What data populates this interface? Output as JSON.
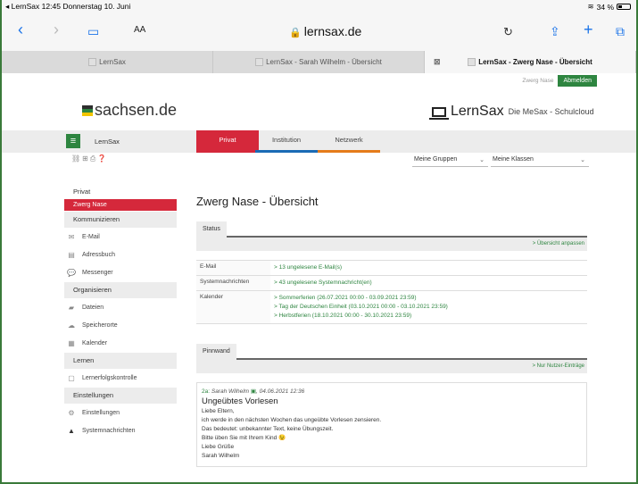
{
  "status_bar": {
    "back_app": "◂ LernSax",
    "time": "12:45",
    "date": "Donnerstag 10. Juni",
    "battery": "34 %"
  },
  "browser": {
    "text_size": "AA",
    "url": "lernsax.de",
    "tabs": [
      {
        "label": "LernSax"
      },
      {
        "label": "LernSax - Sarah Wilhelm - Übersicht"
      },
      {
        "label": "LernSax - Zwerg Nase - Übersicht"
      }
    ]
  },
  "site": {
    "user_name": "Zwerg Nase",
    "logout": "Abmelden",
    "sachsen_logo": "sachsen.de",
    "lernsax_logo": "LernSax",
    "lernsax_sub": "Die MeSax - Schulcloud",
    "nav_label": "LernSax",
    "nav_tabs": [
      "Privat",
      "Institution",
      "Netzwerk"
    ],
    "dropdown_groups": "Meine Gruppen",
    "dropdown_classes": "Meine Klassen"
  },
  "sidebar": {
    "privat": "Privat",
    "active": "Zwerg Nase",
    "sections": [
      {
        "title": "Kommunizieren",
        "items": [
          {
            "label": "E-Mail",
            "icon": "mail-icon"
          },
          {
            "label": "Adressbuch",
            "icon": "addressbook-icon"
          },
          {
            "label": "Messenger",
            "icon": "messenger-icon"
          }
        ]
      },
      {
        "title": "Organisieren",
        "items": [
          {
            "label": "Dateien",
            "icon": "folder-icon"
          },
          {
            "label": "Speicherorte",
            "icon": "cloud-icon"
          },
          {
            "label": "Kalender",
            "icon": "calendar-icon"
          }
        ]
      },
      {
        "title": "Lernen",
        "items": [
          {
            "label": "Lernerfolgskontrolle",
            "icon": "clipboard-icon"
          }
        ]
      },
      {
        "title": "Einstellungen",
        "items": [
          {
            "label": "Einstellungen",
            "icon": "gear-icon"
          },
          {
            "label": "Systemnachrichten",
            "icon": "warning-icon"
          }
        ]
      }
    ]
  },
  "main": {
    "title": "Zwerg Nase - Übersicht",
    "status_tab": "Status",
    "customize_link": "> Übersicht anpassen",
    "rows": [
      {
        "key": "E-Mail",
        "values": [
          "> 13 ungelesene E-Mail(s)"
        ]
      },
      {
        "key": "Systemnachrichten",
        "values": [
          "> 43 ungelesene Systemnachricht(en)"
        ]
      },
      {
        "key": "Kalender",
        "values": [
          "> Sommerferien (26.07.2021 00:00 - 03.09.2021 23:59)",
          "> Tag der Deutschen Einheit (03.10.2021 00:00 - 03.10.2021 23:59)",
          "> Herbstferien (18.10.2021 00:00 - 30.10.2021 23:59)"
        ]
      }
    ],
    "pinnwand_tab": "Pinnwand",
    "user_entries_link": "> Nur Nutzer-Einträge",
    "post": {
      "class": "2a:",
      "author": "Sarah Wilhelm",
      "date": ", 04.06.2021 12:36",
      "title": "Ungeübtes Vorlesen",
      "lines": [
        "Liebe Eltern,",
        "ich werde in den nächsten Wochen das ungeübte Vorlesen zensieren.",
        "Das bedeutet: unbekannter Text, keine Übungszeit.",
        "Bitte üben Sie mit Ihrem Kind 😉",
        "Liebe Grüße",
        "Sarah Wilhelm"
      ]
    }
  }
}
